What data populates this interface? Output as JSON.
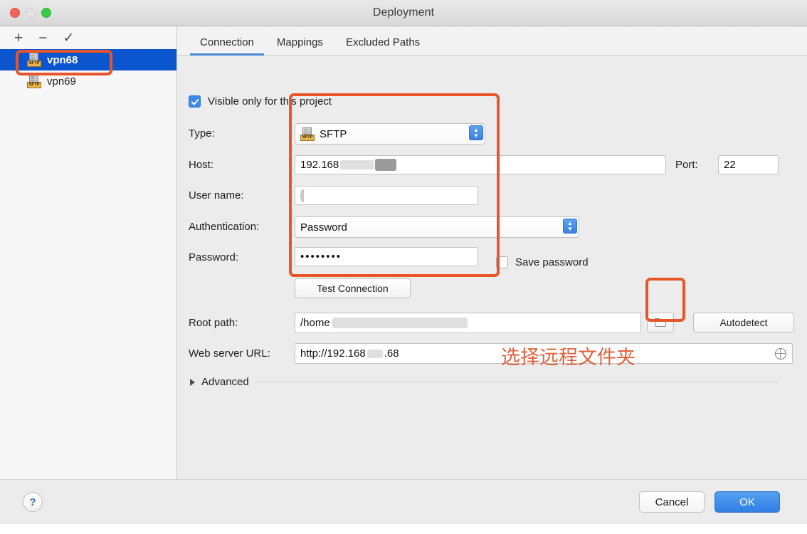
{
  "window": {
    "title": "Deployment",
    "traffic_lights": [
      "close-button",
      "minimize-button",
      "maximize-button"
    ]
  },
  "sidebar": {
    "toolbar": {
      "add_label": "+",
      "remove_label": "−",
      "check_label": "✓"
    },
    "items": [
      {
        "label": "vpn68",
        "type_badge": "SFTP",
        "selected": true
      },
      {
        "label": "vpn69",
        "type_badge": "SFTP",
        "selected": false
      }
    ]
  },
  "tabs": [
    {
      "label": "Connection",
      "active": true
    },
    {
      "label": "Mappings",
      "active": false
    },
    {
      "label": "Excluded Paths",
      "active": false
    }
  ],
  "form": {
    "visible_only_checkbox": {
      "label": "Visible only for this project",
      "checked": true
    },
    "type": {
      "label": "Type:",
      "value": "SFTP",
      "badge": "SFTP"
    },
    "host": {
      "label": "Host:",
      "value": "192.168",
      "redacted": true
    },
    "port": {
      "label": "Port:",
      "value": "22"
    },
    "username": {
      "label": "User name:",
      "value": "",
      "redacted": true
    },
    "authentication": {
      "label": "Authentication:",
      "value": "Password"
    },
    "password": {
      "label": "Password:",
      "value": "••••••••"
    },
    "save_password": {
      "label": "Save password",
      "checked": false
    },
    "test_connection": {
      "label": "Test Connection"
    },
    "root_path": {
      "label": "Root path:",
      "value": "/home",
      "redacted": true
    },
    "browse_button": {
      "icon": "folder-icon"
    },
    "autodetect": {
      "label": "Autodetect"
    },
    "web_server_url": {
      "label": "Web server URL:",
      "value": "http://192.168",
      "value_suffix": ".68",
      "globe_icon": "globe-icon"
    },
    "advanced": {
      "label": "Advanced",
      "expanded": false
    }
  },
  "annotations": {
    "highlight_color": "#e8552a",
    "note_text": "选择远程文件夹",
    "note_color": "#e2603a"
  },
  "footer": {
    "help_label": "?",
    "cancel_label": "Cancel",
    "ok_label": "OK"
  },
  "colors": {
    "selection_blue": "#0b55cf",
    "tab_underline": "#4a86d8",
    "accent_button": "#2f7fe4"
  }
}
